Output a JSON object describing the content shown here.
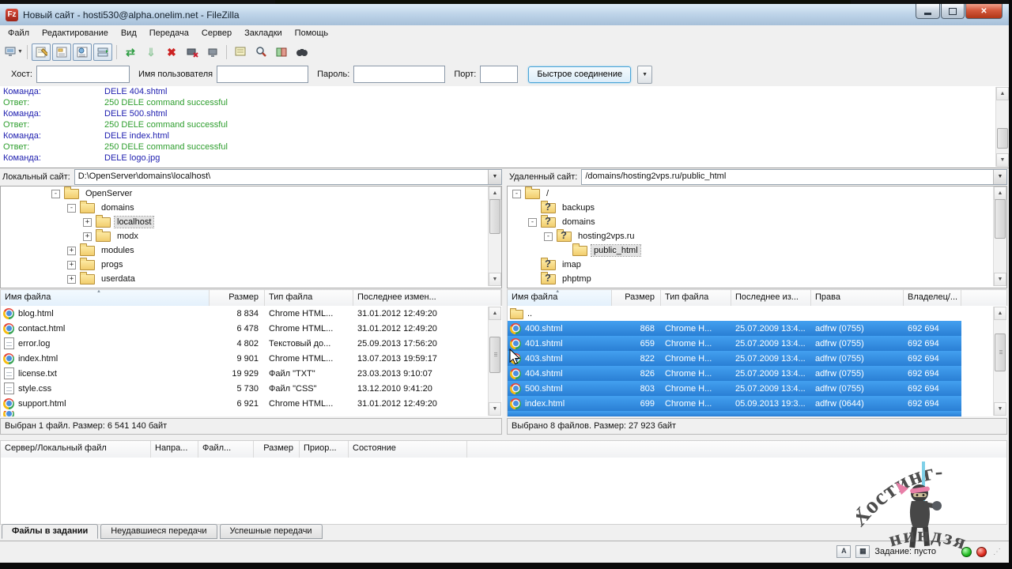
{
  "colors": {
    "selection": "#2e86dd",
    "command_text": "#2020b0",
    "response_text": "#2e9e2e",
    "close_button": "#b03617",
    "folder": "#f2cd6e"
  },
  "window": {
    "title": "Новый сайт - hosti530@alpha.onelim.net - FileZilla"
  },
  "menu": {
    "items": [
      "Файл",
      "Редактирование",
      "Вид",
      "Передача",
      "Сервер",
      "Закладки",
      "Помощь"
    ]
  },
  "toolbar": {
    "icons": [
      "site-manager",
      "toggle-message-log",
      "toggle-local-tree",
      "toggle-remote-tree",
      "toggle-queue",
      "refresh",
      "process-queue",
      "cancel",
      "disconnect",
      "reconnect",
      "filter",
      "find",
      "compare",
      "sync-browse"
    ]
  },
  "quickconnect": {
    "host_label": "Хост:",
    "user_label": "Имя пользователя",
    "pass_label": "Пароль:",
    "port_label": "Порт:",
    "button": "Быстрое соединение"
  },
  "log": {
    "lines": [
      {
        "label": "Команда:",
        "text": "DELE 404.shtml",
        "cls": "cmd"
      },
      {
        "label": "Ответ:",
        "text": "250 DELE command successful",
        "cls": "resp"
      },
      {
        "label": "Команда:",
        "text": "DELE 500.shtml",
        "cls": "cmd"
      },
      {
        "label": "Ответ:",
        "text": "250 DELE command successful",
        "cls": "resp"
      },
      {
        "label": "Команда:",
        "text": "DELE index.html",
        "cls": "cmd"
      },
      {
        "label": "Ответ:",
        "text": "250 DELE command successful",
        "cls": "resp"
      },
      {
        "label": "Команда:",
        "text": "DELE logo.jpg",
        "cls": "cmd"
      }
    ]
  },
  "local": {
    "label": "Локальный сайт:",
    "path": "D:\\OpenServer\\domains\\localhost\\",
    "tree": [
      {
        "name": "OpenServer",
        "expander": "-",
        "icon": "",
        "cls": "lvl-0"
      },
      {
        "name": "domains",
        "expander": "-",
        "icon": "",
        "cls": "lvl-1"
      },
      {
        "name": "localhost",
        "expander": "+",
        "icon": "",
        "cls": "lvl-2 sel"
      },
      {
        "name": "modx",
        "expander": "+",
        "icon": "",
        "cls": "lvl-2"
      },
      {
        "name": "modules",
        "expander": "+",
        "icon": "",
        "cls": "lvl-1"
      },
      {
        "name": "progs",
        "expander": "+",
        "icon": "",
        "cls": "lvl-1"
      },
      {
        "name": "userdata",
        "expander": "+",
        "icon": "",
        "cls": "lvl-1"
      }
    ],
    "columns": [
      "Имя файла",
      "Размер",
      "Тип файла",
      "Последнее измен..."
    ],
    "files": [
      {
        "name": "blog.html",
        "size": "8 834",
        "type": "Chrome HTML...",
        "modified": "31.01.2012 12:49:20",
        "icon": "icon-chrome",
        "cls": ""
      },
      {
        "name": "contact.html",
        "size": "6 478",
        "type": "Chrome HTML...",
        "modified": "31.01.2012 12:49:20",
        "icon": "icon-chrome",
        "cls": ""
      },
      {
        "name": "error.log",
        "size": "4 802",
        "type": "Текстовый до...",
        "modified": "25.09.2013 17:56:20",
        "icon": "icon-text",
        "cls": ""
      },
      {
        "name": "index.html",
        "size": "9 901",
        "type": "Chrome HTML...",
        "modified": "13.07.2013 19:59:17",
        "icon": "icon-chrome",
        "cls": ""
      },
      {
        "name": "license.txt",
        "size": "19 929",
        "type": "Файл \"TXT\"",
        "modified": "23.03.2013 9:10:07",
        "icon": "icon-text",
        "cls": ""
      },
      {
        "name": "style.css",
        "size": "5 730",
        "type": "Файл \"CSS\"",
        "modified": "13.12.2010 9:41:20",
        "icon": "icon-text",
        "cls": ""
      },
      {
        "name": "support.html",
        "size": "6 921",
        "type": "Chrome HTML...",
        "modified": "31.01.2012 12:49:20",
        "icon": "icon-chrome",
        "cls": ""
      },
      {
        "name": "",
        "size": "",
        "type": "",
        "modified": "",
        "icon": "icon-chrome",
        "cls": "partial"
      }
    ],
    "status": "Выбран 1 файл. Размер: 6 541 140 байт"
  },
  "remote": {
    "label": "Удаленный сайт:",
    "path": "/domains/hosting2vps.ru/public_html",
    "tree": [
      {
        "name": "/",
        "expander": "-",
        "icon": "",
        "cls": "lvl-0"
      },
      {
        "name": "backups",
        "expander": "",
        "icon": "folderq",
        "cls": "lvl-1"
      },
      {
        "name": "domains",
        "expander": "-",
        "icon": "folderq",
        "cls": "lvl-1"
      },
      {
        "name": "hosting2vps.ru",
        "expander": "-",
        "icon": "folderq",
        "cls": "lvl-2"
      },
      {
        "name": "public_html",
        "expander": "",
        "icon": "",
        "cls": "lvl-3 sel"
      },
      {
        "name": "imap",
        "expander": "",
        "icon": "folderq",
        "cls": "lvl-1"
      },
      {
        "name": "phptmp",
        "expander": "",
        "icon": "folderq",
        "cls": "lvl-1"
      }
    ],
    "columns": [
      "Имя файла",
      "Размер",
      "Тип файла",
      "Последнее из...",
      "Права",
      "Владелец/..."
    ],
    "files": [
      {
        "name": "..",
        "size": "",
        "type": "",
        "modified": "",
        "perms": "",
        "owner": "",
        "icon": "icon-folder",
        "cls": ""
      },
      {
        "name": "400.shtml",
        "size": "868",
        "type": "Chrome H...",
        "modified": "25.07.2009 13:4...",
        "perms": "adfrw (0755)",
        "owner": "692 694",
        "icon": "icon-chrome",
        "cls": "selected"
      },
      {
        "name": "401.shtml",
        "size": "659",
        "type": "Chrome H...",
        "modified": "25.07.2009 13:4...",
        "perms": "adfrw (0755)",
        "owner": "692 694",
        "icon": "icon-chrome",
        "cls": "selected"
      },
      {
        "name": "403.shtml",
        "size": "822",
        "type": "Chrome H...",
        "modified": "25.07.2009 13:4...",
        "perms": "adfrw (0755)",
        "owner": "692 694",
        "icon": "icon-chrome",
        "cls": "selected"
      },
      {
        "name": "404.shtml",
        "size": "826",
        "type": "Chrome H...",
        "modified": "25.07.2009 13:4...",
        "perms": "adfrw (0755)",
        "owner": "692 694",
        "icon": "icon-chrome",
        "cls": "selected"
      },
      {
        "name": "500.shtml",
        "size": "803",
        "type": "Chrome H...",
        "modified": "25.07.2009 13:4...",
        "perms": "adfrw (0755)",
        "owner": "692 694",
        "icon": "icon-chrome",
        "cls": "selected"
      },
      {
        "name": "index.html",
        "size": "699",
        "type": "Chrome H...",
        "modified": "05.09.2013 19:3...",
        "perms": "adfrw (0644)",
        "owner": "692 694",
        "icon": "icon-chrome",
        "cls": "selected"
      },
      {
        "name": "",
        "size": "",
        "type": "",
        "modified": "",
        "perms": "",
        "owner": "",
        "icon": "",
        "cls": "selected partial"
      }
    ],
    "status": "Выбрано 8 файлов. Размер: 27 923 байт"
  },
  "queue": {
    "columns": [
      "Сервер/Локальный файл",
      "Напра...",
      "Файл...",
      "Размер",
      "Приор...",
      "Состояние"
    ],
    "tabs": [
      {
        "label": "Файлы в задании",
        "cls": "active"
      },
      {
        "label": "Неудавшиеся передачи",
        "cls": ""
      },
      {
        "label": "Успешные передачи",
        "cls": ""
      }
    ]
  },
  "statusbar": {
    "queue_text": "Задание: пусто"
  },
  "watermark": {
    "line1": "Хостинг-",
    "line2": "ниндзя"
  }
}
